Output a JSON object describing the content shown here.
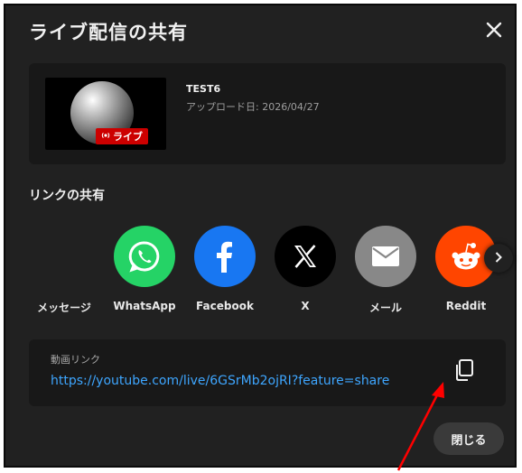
{
  "dialog": {
    "title": "ライブ配信の共有",
    "close_label": "✕"
  },
  "video": {
    "title": "TEST6",
    "upload_date": "アップロード日: 2026/04/27",
    "badge": "ライブ",
    "badge_icon": "live-icon"
  },
  "share": {
    "section_label": "リンクの共有",
    "items": [
      {
        "label": "メッセージ",
        "icon": "message-icon",
        "color": "#3a3a3a"
      },
      {
        "label": "WhatsApp",
        "icon": "whatsapp-icon",
        "color": "#25d366"
      },
      {
        "label": "Facebook",
        "icon": "facebook-icon",
        "color": "#1877f2"
      },
      {
        "label": "X",
        "icon": "x-icon",
        "color": "#000000"
      },
      {
        "label": "メール",
        "icon": "mail-icon",
        "color": "#888888"
      },
      {
        "label": "Reddit",
        "icon": "reddit-icon",
        "color": "#ff4500"
      }
    ],
    "next_icon": "chevron-right-icon"
  },
  "link": {
    "label": "動画リンク",
    "url": "https://youtube.com/live/6GSrMb2ojRI?feature=share",
    "copy_icon": "copy-icon"
  },
  "footer": {
    "close_button": "閉じる"
  },
  "annotation": {
    "arrow_color": "#ff0000"
  }
}
